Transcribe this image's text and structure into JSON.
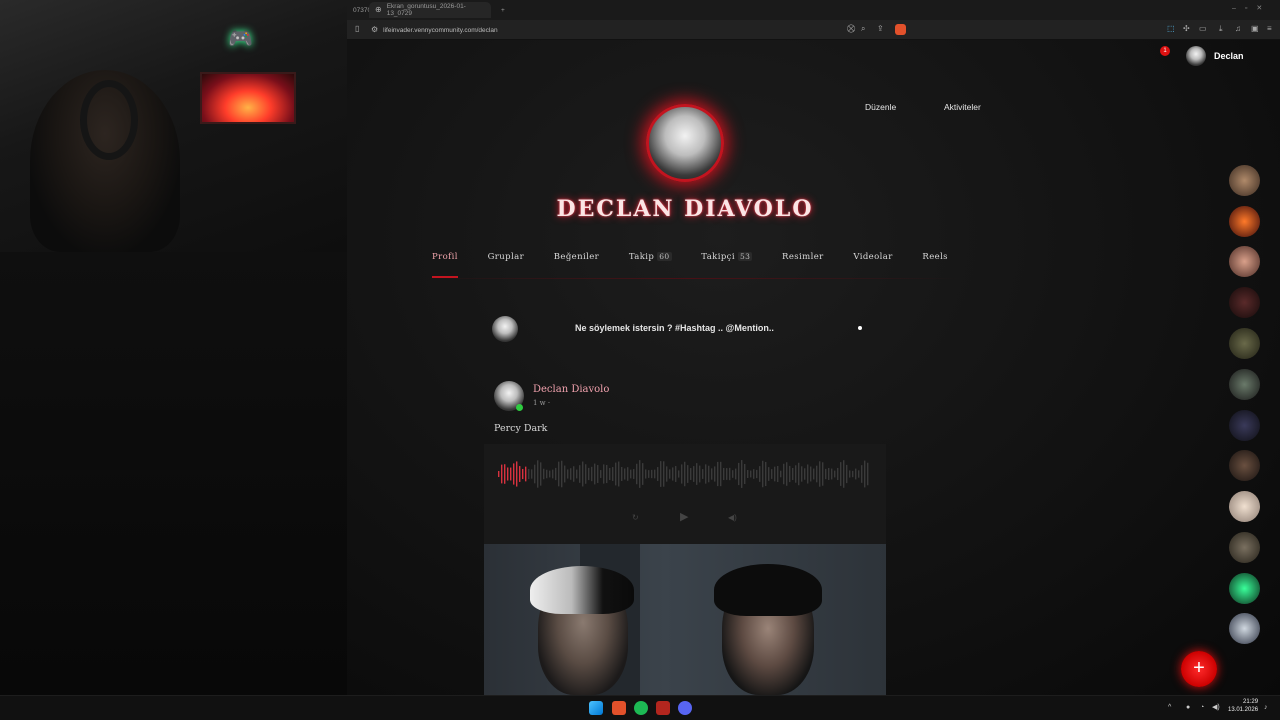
{
  "browser": {
    "tabs": [
      {
        "label": "07370",
        "active": false
      },
      {
        "label": "Ekran_goruntusu_2026-01-13_0729",
        "active": true
      },
      {
        "label": "+",
        "active": false
      }
    ],
    "url": "lifeinvader.vennycommunity.com/declan"
  },
  "header": {
    "username": "Declan",
    "notification_count": "1",
    "edit_label": "Düzenle",
    "activities_label": "Aktiviteler"
  },
  "profile": {
    "display_name": "DECLAN DIAVOLO",
    "tabs": [
      {
        "label": "Profil",
        "count": "",
        "active": true
      },
      {
        "label": "Gruplar",
        "count": ""
      },
      {
        "label": "Beğeniler",
        "count": ""
      },
      {
        "label": "Takip",
        "count": "60"
      },
      {
        "label": "Takipçi",
        "count": "53"
      },
      {
        "label": "Resimler",
        "count": ""
      },
      {
        "label": "Videolar",
        "count": ""
      },
      {
        "label": "Reels",
        "count": ""
      }
    ]
  },
  "composer": {
    "prompt": "Ne söylemek istersin ? #Hashtag .. @Mention.."
  },
  "post": {
    "author": "Declan Diavolo",
    "time": "1 w ·",
    "text": "Percy Dark"
  },
  "colors": {
    "accent": "#c3141f",
    "name_glow": "#e01a2e",
    "online": "#2ecc40"
  },
  "icons": [
    "bookmark-icon",
    "lock-icon",
    "zoom-icon",
    "share-icon",
    "brave-icon",
    "plus-icon",
    "windows-icon",
    "spotify-icon",
    "discord-icon",
    "bell-icon"
  ],
  "taskbar": {
    "time": "21:29",
    "date": "13.01.2026"
  }
}
